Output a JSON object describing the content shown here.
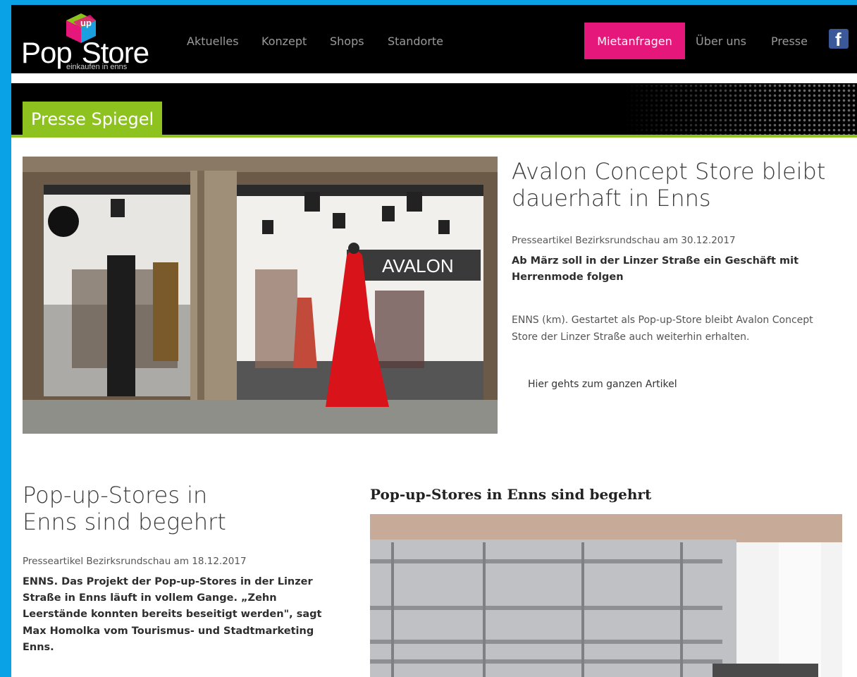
{
  "brand": {
    "logo_word_1": "Pop",
    "logo_word_2": "Store",
    "logo_badge": "up",
    "tagline": "einkaufen in enns"
  },
  "nav": {
    "items": [
      "Aktuelles",
      "Konzept",
      "Shops",
      "Standorte"
    ],
    "cta": "Mietanfragen",
    "right_items": [
      "Über uns",
      "Presse"
    ],
    "social_icon": "facebook-icon"
  },
  "section": {
    "title": "Presse Spiegel"
  },
  "articles": [
    {
      "headline": "Avalon Concept Store bleibt dauerhaft in Enns",
      "meta": "Presseartikel Bezirksrundschau am 30.12.2017",
      "lead": "Ab März soll in der Linzer Straße ein Geschäft mit Herrenmode folgen",
      "body": "ENNS (km). Gestartet als Pop-up-Store bleibt Avalon Concept Store der Linzer Straße auch weiterhin erhalten.",
      "link": "Hier gehts zum ganzen Artikel",
      "image_sign": "AVALON"
    },
    {
      "headline": "Pop-up-Stores in Enns sind begehrt",
      "meta": "Presseartikel Bezirksrundschau am 18.12.2017",
      "lead": "ENNS. Das Projekt der Pop-up-Stores in der Linzer Straße in Enns läuft in vollem Gange. „Zehn Leerstände konnten bereits beseitigt werden\", sagt Max Homolka vom Tourismus- und Stadtmarketing Enns.",
      "side_title": "Pop-up-Stores in Enns sind begehrt"
    }
  ],
  "colors": {
    "page_bg": "#0aa2e6",
    "nav_bg": "#000000",
    "cta": "#e6177a",
    "accent_green": "#8dc21f",
    "facebook": "#3b5998"
  }
}
